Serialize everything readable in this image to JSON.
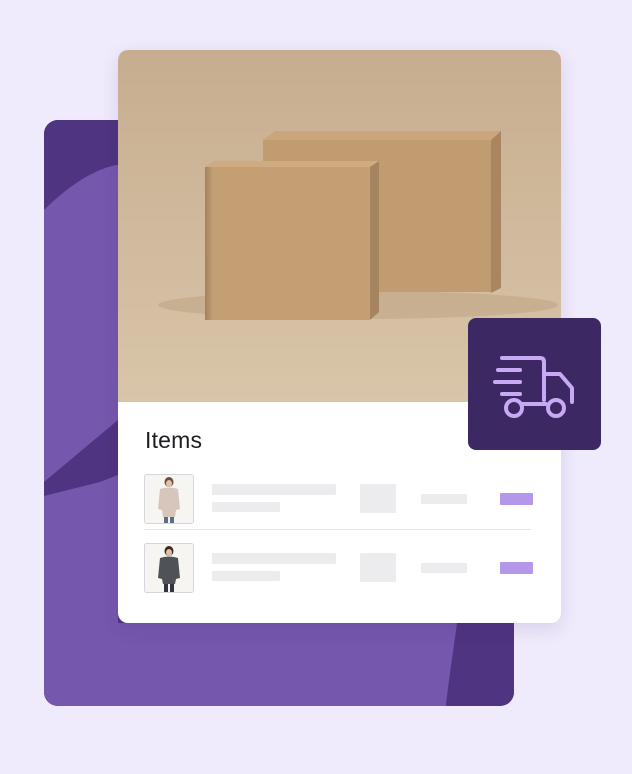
{
  "colors": {
    "page_background": "#efeafc",
    "backdrop_dark": "#4f3481",
    "backdrop_light": "#7657ae",
    "badge": "#3c2964",
    "badge_icon": "#c7a9f4",
    "accent": "#b497e8",
    "placeholder": "#ececee"
  },
  "card": {
    "hero_image": "cardboard-boxes-photo",
    "items_heading": "Items",
    "rows": [
      {
        "thumbnail": "beige-long-sleeve-top"
      },
      {
        "thumbnail": "grey-long-sleeve-top"
      }
    ]
  },
  "badge": {
    "icon": "delivery-truck-icon"
  }
}
